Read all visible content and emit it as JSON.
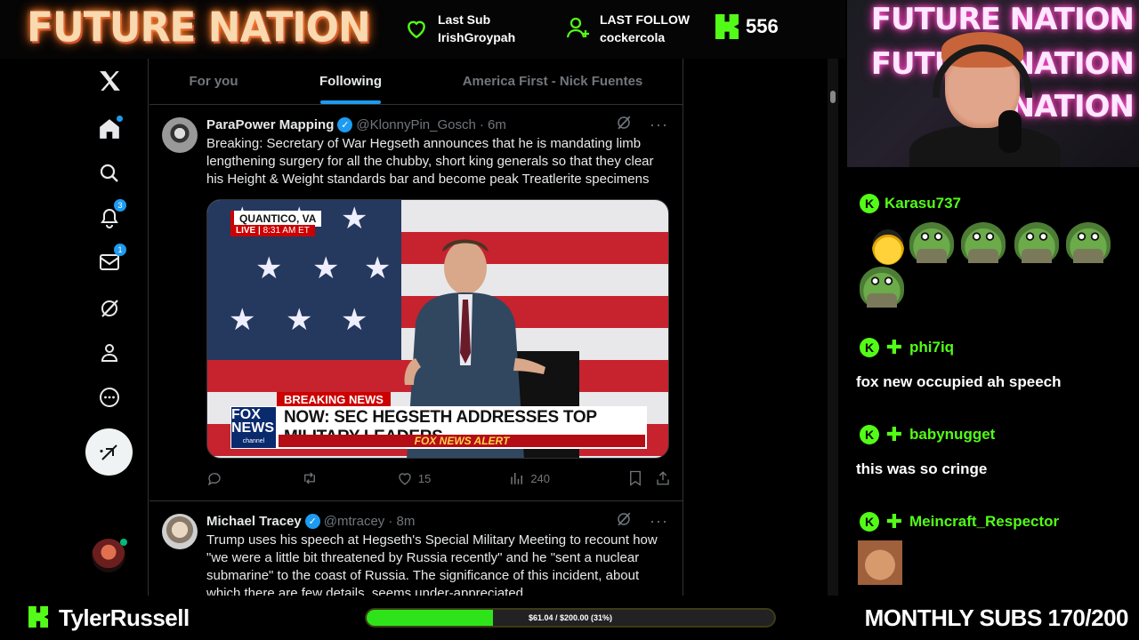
{
  "overlay": {
    "brand": "FUTURE NATION",
    "last_sub": {
      "label": "Last Sub",
      "value": "IrishGroypah"
    },
    "last_follow": {
      "label": "LAST FOLLOW",
      "value": "cockercola"
    },
    "viewer_count": "556",
    "accent_color": "#53fc18"
  },
  "nav": {
    "notifications_badge": "3",
    "messages_badge": "1"
  },
  "timeline": {
    "tabs": [
      {
        "label": "For you"
      },
      {
        "label": "Following"
      },
      {
        "label": "America First - Nick Fuentes"
      }
    ],
    "active_tab": "Following",
    "tweets": [
      {
        "name": "ParaPower Mapping",
        "handle": "@KlonnyPin_Gosch",
        "time": "· 6m",
        "text": "Breaking: Secretary of War Hegseth announces that he is mandating limb lengthening surgery for all the chubby, short king generals so that they clear his Height & Weight standards bar and become peak Treatlerite specimens",
        "media": {
          "location": "QUANTICO, VA",
          "live": "LIVE",
          "live_time": "8:31 AM ET",
          "breaking": "BREAKING NEWS",
          "headline": "NOW: SEC HEGSETH ADDRESSES TOP MILITARY LEADERS",
          "network": "FOX NEWS",
          "network_sub": "channel",
          "alert": "FOX NEWS ALERT"
        },
        "likes": "15",
        "views": "240"
      },
      {
        "name": "Michael Tracey",
        "handle": "@mtracey",
        "time": "· 8m",
        "text": "Trump uses his speech at Hegseth's Special Military Meeting to recount how \"we were a little bit threatened by Russia recently\" and he \"sent a nuclear submarine\" to the coast of Russia. The significance of this incident, about which there are few details, seems under-appreciated"
      }
    ]
  },
  "webcam": {
    "neon_lines": [
      "FUTURE NATION",
      "FUTURE NATION",
      "NATION"
    ]
  },
  "chat": {
    "messages": [
      {
        "user": "Karasu737",
        "text": ""
      },
      {
        "user": "phi7iq",
        "text": "fox new occupied ah speech"
      },
      {
        "user": "babynugget",
        "text": "this was so cringe"
      },
      {
        "user": "Meincraft_Respector",
        "text": ""
      }
    ]
  },
  "bottom": {
    "streamer": "TylerRussell",
    "goal_text": "$61.04 / $200.00 (31%)",
    "goal_progress": 0.31,
    "monthly_subs": "MONTHLY SUBS 170/200"
  }
}
